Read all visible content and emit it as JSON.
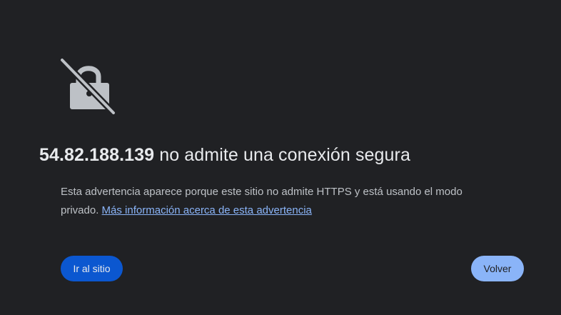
{
  "interstitial": {
    "icon": "lock-slash-icon",
    "host": "54.82.188.139",
    "headline_rest": "no admite una conexión segura",
    "description": "Esta advertencia aparece porque este sitio no admite HTTPS y está usando el modo privado.",
    "learn_more_link": "Más información acerca de esta advertencia"
  },
  "buttons": {
    "proceed_label": "Ir al sitio",
    "back_label": "Volver"
  },
  "colors": {
    "background": "#202124",
    "primary_button": "#0b57d0",
    "secondary_button": "#8ab4f8",
    "link": "#8ab4f8"
  }
}
